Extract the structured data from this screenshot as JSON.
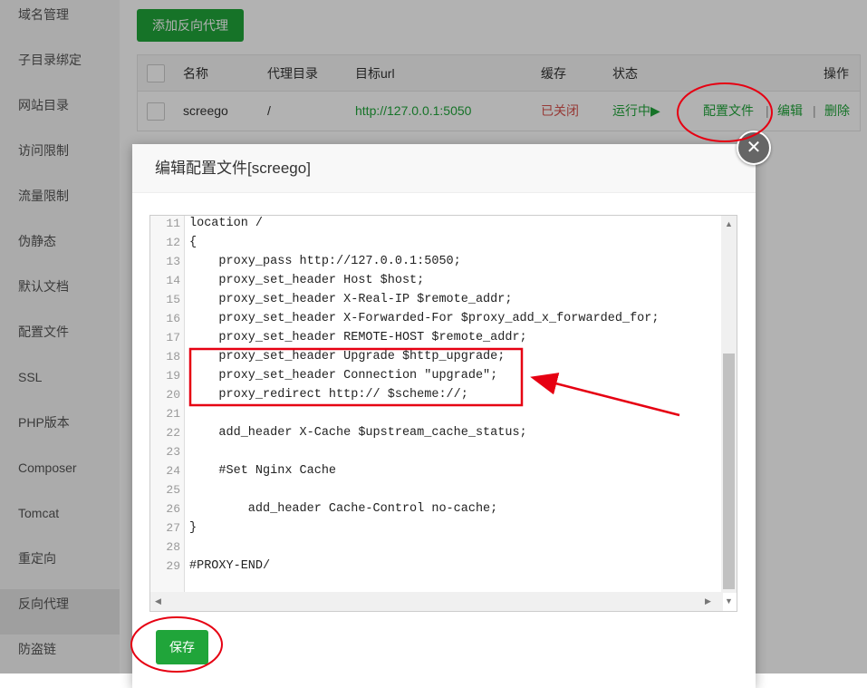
{
  "sidebar": {
    "items": [
      {
        "label": "域名管理"
      },
      {
        "label": "子目录绑定"
      },
      {
        "label": "网站目录"
      },
      {
        "label": "访问限制"
      },
      {
        "label": "流量限制"
      },
      {
        "label": "伪静态"
      },
      {
        "label": "默认文档"
      },
      {
        "label": "配置文件"
      },
      {
        "label": "SSL"
      },
      {
        "label": "PHP版本"
      },
      {
        "label": "Composer"
      },
      {
        "label": "Tomcat"
      },
      {
        "label": "重定向"
      },
      {
        "label": "反向代理"
      },
      {
        "label": "防盗链"
      }
    ],
    "active_index": 13
  },
  "toolbar": {
    "add_label": "添加反向代理"
  },
  "table": {
    "headers": {
      "name": "名称",
      "dir": "代理目录",
      "url": "目标url",
      "cache": "缓存",
      "status": "状态",
      "ops": "操作"
    },
    "row": {
      "name": "screego",
      "dir": "/",
      "url": "http://127.0.0.1:5050",
      "cache": "已关闭",
      "status": "运行中▶",
      "config": "配置文件",
      "sep": "|",
      "edit": "编辑",
      "delete": "删除"
    }
  },
  "dialog": {
    "title": "编辑配置文件[screego]",
    "close_glyph": "✕",
    "save_label": "保存",
    "lines": [
      {
        "n": "11",
        "code": "location /"
      },
      {
        "n": "12",
        "code": "{"
      },
      {
        "n": "13",
        "code": "    proxy_pass http://127.0.0.1:5050;"
      },
      {
        "n": "14",
        "code": "    proxy_set_header Host $host;"
      },
      {
        "n": "15",
        "code": "    proxy_set_header X-Real-IP $remote_addr;"
      },
      {
        "n": "16",
        "code": "    proxy_set_header X-Forwarded-For $proxy_add_x_forwarded_for;"
      },
      {
        "n": "17",
        "code": "    proxy_set_header REMOTE-HOST $remote_addr;"
      },
      {
        "n": "18",
        "code": "    proxy_set_header Upgrade $http_upgrade;"
      },
      {
        "n": "19",
        "code": "    proxy_set_header Connection \"upgrade\";"
      },
      {
        "n": "20",
        "code": "    proxy_redirect http:// $scheme://;"
      },
      {
        "n": "21",
        "code": ""
      },
      {
        "n": "22",
        "code": "    add_header X-Cache $upstream_cache_status;"
      },
      {
        "n": "23",
        "code": ""
      },
      {
        "n": "24",
        "code": "    #Set Nginx Cache"
      },
      {
        "n": "25",
        "code": ""
      },
      {
        "n": "26",
        "code": "        add_header Cache-Control no-cache;"
      },
      {
        "n": "27",
        "code": "}"
      },
      {
        "n": "28",
        "code": ""
      },
      {
        "n": "29",
        "code": "#PROXY-END/"
      }
    ]
  },
  "colors": {
    "accent": "#20a53a",
    "danger": "#d9534f",
    "annotation": "#e60012"
  }
}
